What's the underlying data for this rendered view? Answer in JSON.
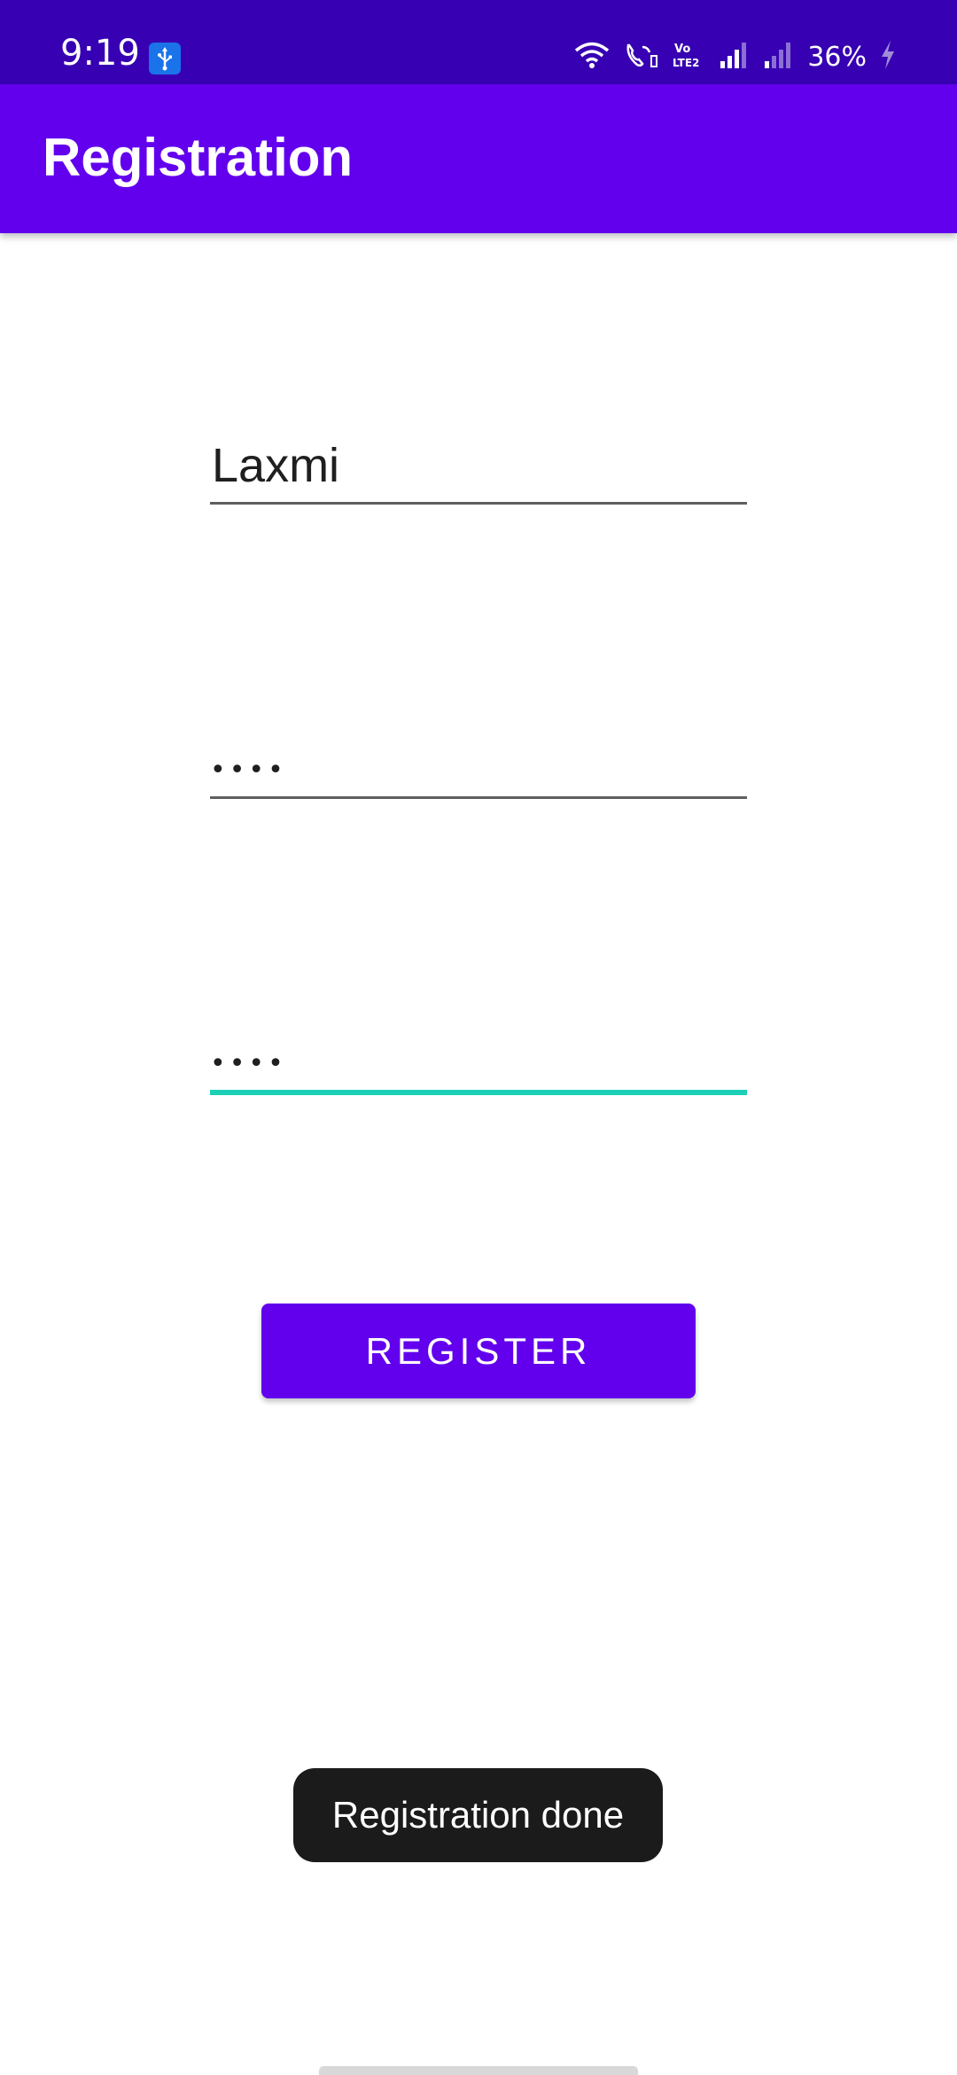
{
  "status_bar": {
    "time": "9:19",
    "battery": "36%",
    "background": "#3700b3",
    "icons": [
      "usb-icon",
      "wifi-icon",
      "wifi-calling-icon",
      "volte-icon",
      "signal-icon",
      "signal-weak-icon",
      "charging-icon"
    ]
  },
  "app_bar": {
    "title": "Registration",
    "background": "#6200ee"
  },
  "form": {
    "username_value": "Laxmi",
    "password_value": "••••",
    "confirm_password_value": "••••",
    "focus_accent": "#1cd0b7"
  },
  "register_button": {
    "label": "REGISTER",
    "background": "#6200ee"
  },
  "toast": {
    "message": "Registration done"
  }
}
